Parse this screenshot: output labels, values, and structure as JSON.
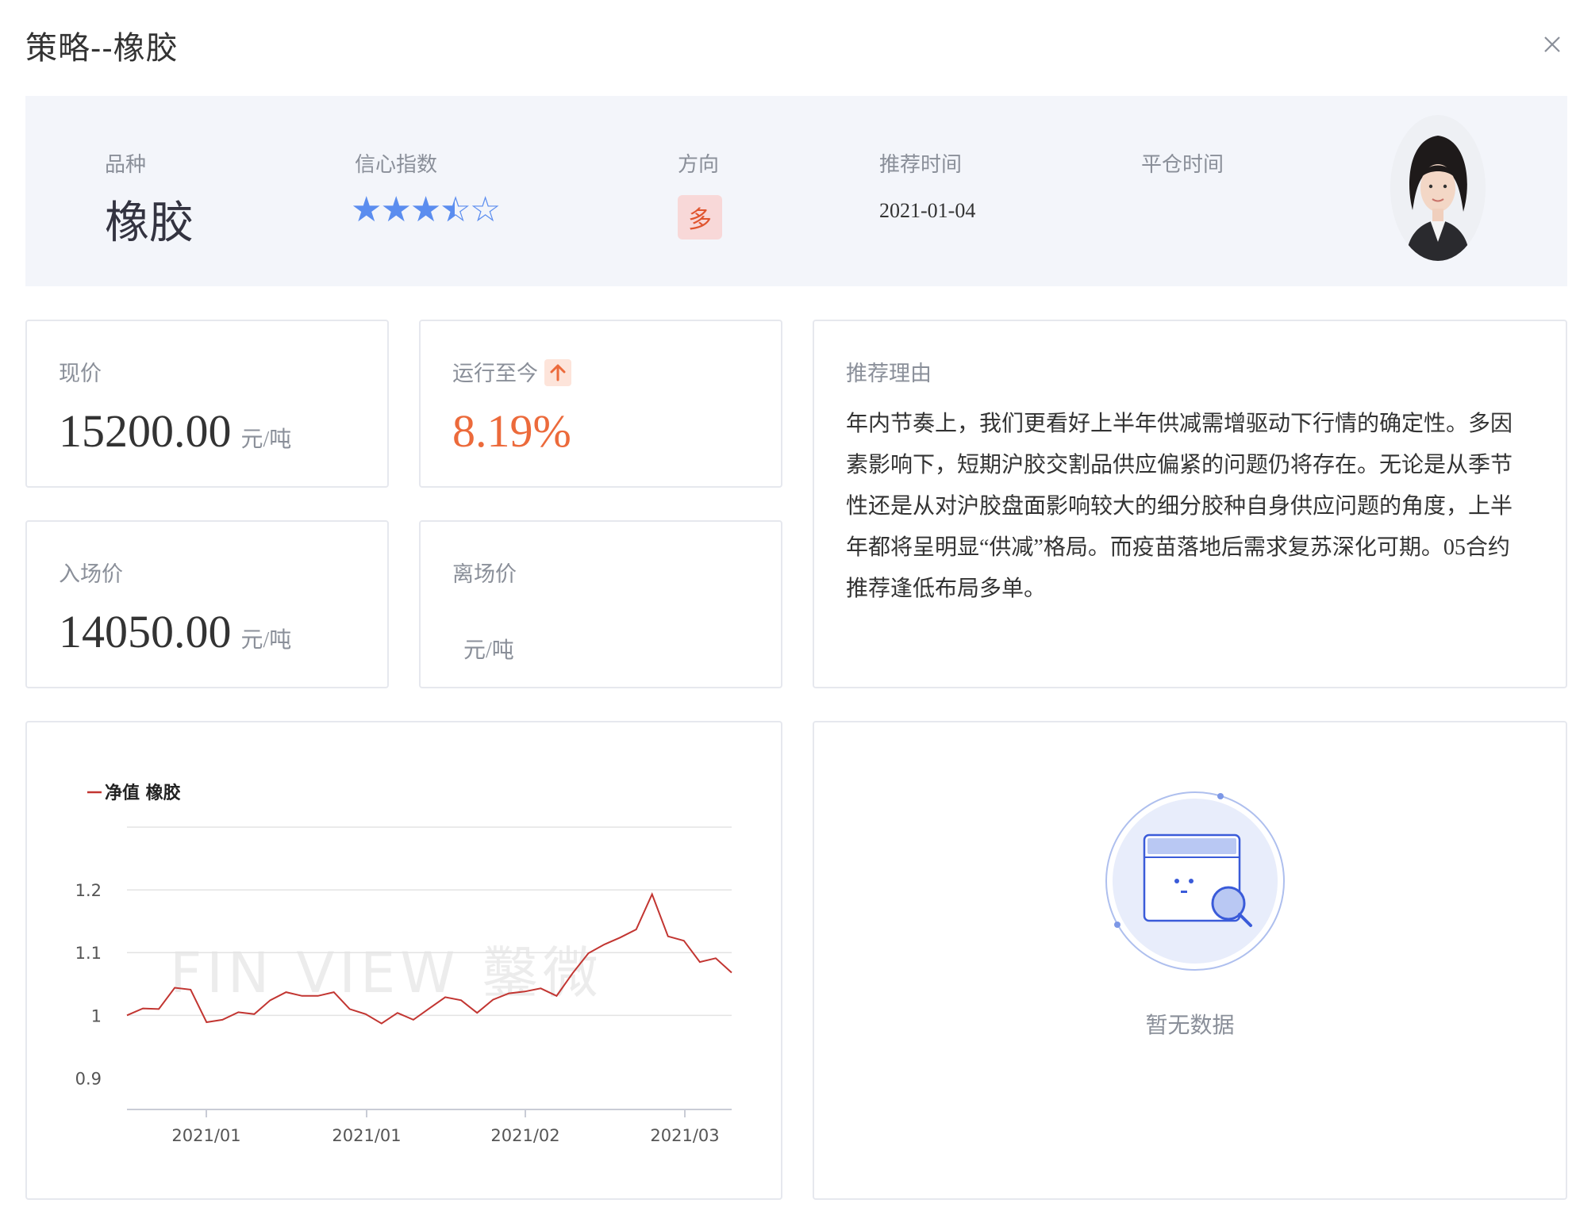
{
  "dialog": {
    "title": "策略--橡胶"
  },
  "summary": {
    "variety_label": "品种",
    "variety_value": "橡胶",
    "confidence_label": "信心指数",
    "confidence_stars": 3.5,
    "confidence_max": 5,
    "direction_label": "方向",
    "direction_value": "多",
    "rec_time_label": "推荐时间",
    "rec_time_value": "2021-01-04",
    "close_time_label": "平仓时间",
    "close_time_value": ""
  },
  "current_price": {
    "label": "现价",
    "value": "15200.00",
    "unit": "元/吨"
  },
  "running": {
    "label": "运行至今",
    "value": "8.19%",
    "trend": "up",
    "color": "#ec6a3b"
  },
  "entry_price": {
    "label": "入场价",
    "value": "14050.00",
    "unit": "元/吨"
  },
  "exit_price": {
    "label": "离场价",
    "value": "",
    "unit": "元/吨"
  },
  "reason": {
    "label": "推荐理由",
    "text": "年内节奏上，我们更看好上半年供减需增驱动下行情的确定性。多因素影响下，短期沪胶交割品供应偏紧的问题仍将存在。无论是从季节性还是从对沪胶盘面影响较大的细分胶种自身供应问题的角度，上半年都将呈明显“供减”格局。而疫苗落地后需求复苏深化可期。05合约推荐逢低布局多单。"
  },
  "empty_panel": {
    "text": "暂无数据"
  },
  "watermark": "FIN VIEW 鑿微",
  "chart_data": {
    "type": "line",
    "title": "",
    "xlabel": "",
    "ylabel": "",
    "legend_position": "top-left",
    "ylim": [
      0.9,
      1.2
    ],
    "yticks": [
      "1.2",
      "1.1",
      "1",
      "0.9"
    ],
    "xticks": [
      "2021/01",
      "2021/01",
      "2021/02",
      "2021/03"
    ],
    "grid": true,
    "series": [
      {
        "name": "净值 橡胶",
        "color": "#c23531",
        "values": [
          1.0,
          1.011,
          1.01,
          1.044,
          1.041,
          0.989,
          0.993,
          1.005,
          1.002,
          1.024,
          1.037,
          1.031,
          1.031,
          1.037,
          1.01,
          1.002,
          0.987,
          1.004,
          0.993,
          1.011,
          1.029,
          1.024,
          1.004,
          1.025,
          1.035,
          1.038,
          1.043,
          1.031,
          1.067,
          1.099,
          1.113,
          1.124,
          1.137,
          1.193,
          1.126,
          1.119,
          1.085,
          1.091,
          1.068
        ]
      }
    ]
  }
}
